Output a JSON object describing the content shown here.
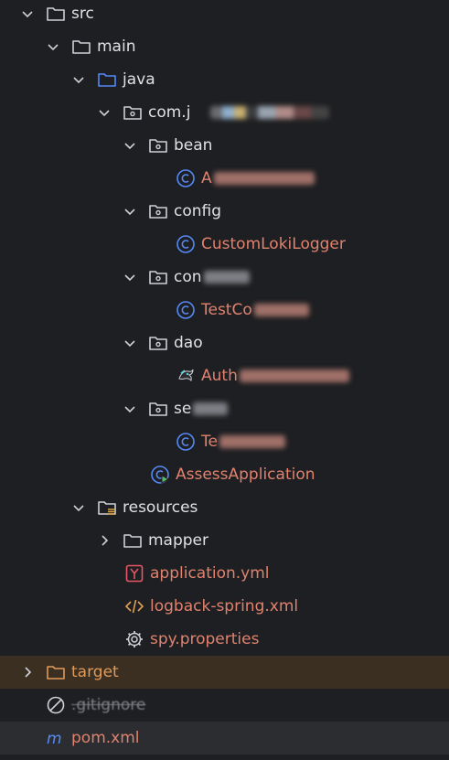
{
  "tree": {
    "src": "src",
    "main": "main",
    "java": "java",
    "com_pkg": "com.j",
    "bean": "bean",
    "bean_class": "A",
    "config": "config",
    "config_class": "CustomLokiLogger",
    "controller_pkg": "con",
    "controller_class": "TestCo",
    "dao": "dao",
    "dao_class": "Auth",
    "service_pkg": "se",
    "service_class": "Te",
    "app_class": "AssessApplication",
    "resources": "resources",
    "mapper": "mapper",
    "application_yml": "application.yml",
    "logback_xml": "logback-spring.xml",
    "spy_properties": "spy.properties",
    "target": "target",
    "gitignore": ".gitignore",
    "pom": "pom.xml"
  },
  "colors": {
    "background": "#1e1f22",
    "folder_icon": "#ced0d6",
    "source_root_icon": "#548af7",
    "class_icon": "#548af7",
    "file_label": "#e0826e",
    "excluded_bg": "#3b2f22",
    "selected_bg": "#2b2d30"
  }
}
